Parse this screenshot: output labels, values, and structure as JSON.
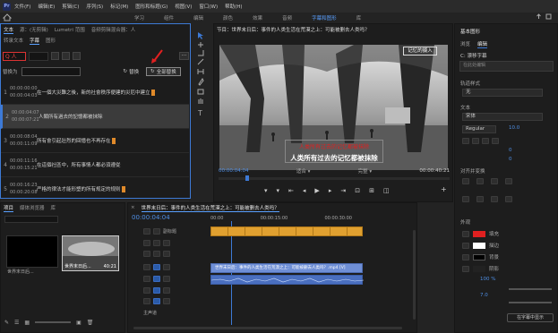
{
  "menu": [
    "文件(F)",
    "编辑(E)",
    "剪辑(C)",
    "序列(S)",
    "标记(M)",
    "图形和标题(G)",
    "视图(V)",
    "窗口(W)",
    "帮助(H)"
  ],
  "workspaces": [
    "学习",
    "组件",
    "编辑",
    "颜色",
    "效果",
    "音频",
    "字幕和图形",
    "库"
  ],
  "text_panel": {
    "tabs": [
      "文本",
      "源：(无剪辑)",
      "Lumetri 范围",
      "音频剪辑混合器：人"
    ],
    "subtabs": [
      "转录文本",
      "字幕",
      "图形"
    ],
    "search_value": "Q 人",
    "replace_label": "替换为",
    "replace_value": "",
    "replace_btn": "替换",
    "replace_all_btn": "全部替换",
    "captions": [
      {
        "num": "1",
        "t1": "00:00:00:00",
        "t2": "00:00:04:03",
        "text": "在一個大災難之後，新的社會秩序便建的災厄中建立"
      },
      {
        "num": "2",
        "t1": "00:00:04:07",
        "t2": "00:00:07:21",
        "text": "人類所有過去的記憶都被抹除"
      },
      {
        "num": "3",
        "t1": "00:00:08:04",
        "t2": "00:00:11:09",
        "text": "所有會引起壯烈的回憶也不再存在"
      },
      {
        "num": "4",
        "t1": "00:00:11:16",
        "t2": "00:00:15:21",
        "text": "在這個社區中，所有事情人都必須遵從"
      },
      {
        "num": "5",
        "t1": "00:00:16:23",
        "t2": "00:00:20:08",
        "text": "严格的律法才能形塑的所有规定的规则"
      }
    ]
  },
  "program": {
    "title": "节目：世界末日后：事件的人类生活在荒漠之上：可能被删去人类吗？",
    "subtitle_red": "人类所有过去的记忆都被抹除",
    "subtitle_white": "人类所有过去的记忆都被抹除",
    "watermark": "记忆的摄入",
    "timecode_left": "00:00:04:04",
    "fit": "适合",
    "full": "完整",
    "timecode_right": "00:00:40:21"
  },
  "right": {
    "title": "基本图形",
    "tabs": [
      "浏览",
      "编辑"
    ],
    "item": "C: 漂移字幕",
    "track_label": "在此处编辑",
    "track_style": "轨道样式",
    "track_style_value": "无",
    "text_label": "文本",
    "font_value": "宋体",
    "style_value": "Regular",
    "align_label": "对齐并变换",
    "appearance_label": "外观",
    "fill": "填充",
    "stroke": "描边",
    "bg": "背景",
    "shadow": "阴影",
    "opacity": "100 %",
    "size1": "10.0",
    "size2": "0",
    "size3": "0",
    "size4": "7.0",
    "btn_bottom": "在字幕中显示"
  },
  "project": {
    "tabs": [
      "项目",
      "媒体浏览器",
      "库"
    ],
    "search": "",
    "file": "世界末日后...",
    "thumb1": "世界末日后...",
    "thumb2": "世界末日后...",
    "dur": "40:21"
  },
  "timeline": {
    "title": "世界末日后：事件的人类生活在荒漠之上：可能被删去人类吗？",
    "timecode": "00:00:04:04",
    "ruler": [
      "00:00",
      "00:00:15:00",
      "00:00:30:00"
    ],
    "caption_track": "副标题",
    "clip_label": "世界末日后：事件的人类生活在荒漠之上：可能被删去人类吗？.mp4 [V]",
    "tracks": [
      "V1",
      "A1",
      "A2",
      "A3"
    ],
    "master": "主声道"
  },
  "colors": {
    "accent": "#3d7ad6",
    "highlight_red": "#d33333",
    "caption_clip": "#e0a030",
    "video_clip": "#6f8fd6"
  }
}
